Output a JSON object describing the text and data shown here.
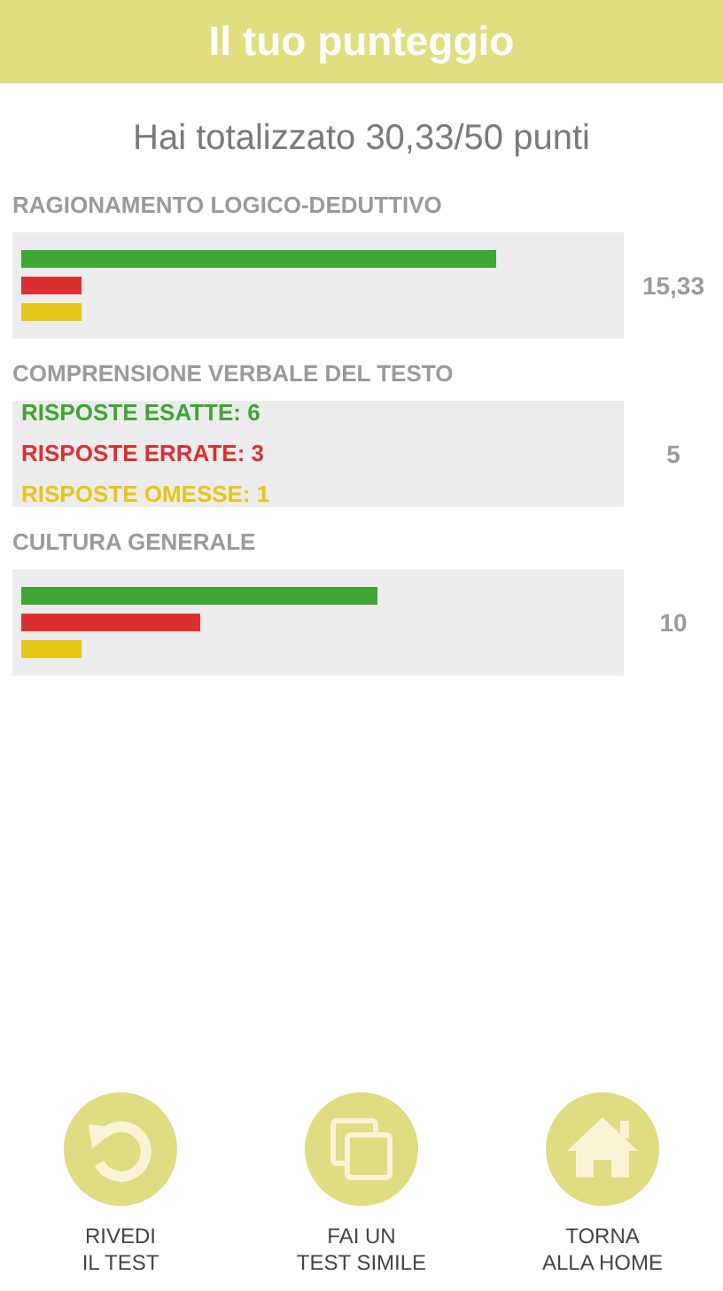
{
  "header": {
    "title": "Il tuo punteggio"
  },
  "summary": "Hai totalizzato 30,33/50 punti",
  "sections": [
    {
      "title": "RAGIONAMENTO LOGICO-DEDUTTIVO",
      "kind": "bars",
      "score": "15,33",
      "bars": [
        {
          "kind": "correct",
          "level": 0.8
        },
        {
          "kind": "wrong",
          "level": 0.1
        },
        {
          "kind": "omitted",
          "level": 0.1
        }
      ]
    },
    {
      "title": "COMPRENSIONE VERBALE DEL TESTO",
      "kind": "counts",
      "score": "5",
      "lines": [
        {
          "kind": "correct",
          "text": "RISPOSTE ESATTE: 6"
        },
        {
          "kind": "wrong",
          "text": "RISPOSTE ERRATE: 3"
        },
        {
          "kind": "omitted",
          "text": "RISPOSTE OMESSE: 1"
        }
      ]
    },
    {
      "title": "CULTURA GENERALE",
      "kind": "bars",
      "score": "10",
      "bars": [
        {
          "kind": "correct",
          "level": 0.6
        },
        {
          "kind": "wrong",
          "level": 0.3
        },
        {
          "kind": "omitted",
          "level": 0.1
        }
      ]
    }
  ],
  "actions": [
    {
      "kind": "review",
      "label": "RIVEDI\nIL TEST"
    },
    {
      "kind": "similar",
      "label": "FAI UN\nTEST SIMILE"
    },
    {
      "kind": "home",
      "label": "TORNA\nALLA HOME"
    }
  ]
}
